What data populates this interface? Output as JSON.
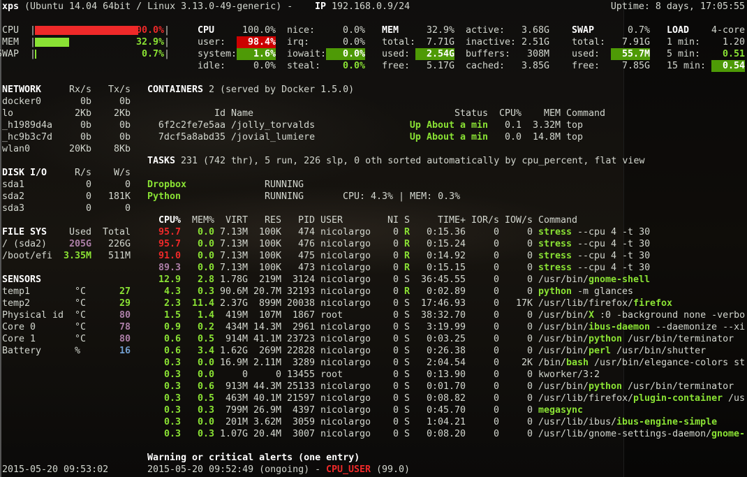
{
  "header": {
    "hostname": "xps",
    "system": "(Ubuntu 14.04 64bit / Linux 3.13.0-49-generic) - ",
    "ip_label": "IP",
    "ip": "192.168.0.9/24",
    "uptime": "Uptime: 8 days, 17:05:55"
  },
  "quicklook": [
    {
      "label": "CPU",
      "percent": 100.0,
      "text": "100.0%",
      "color": "#ef2929"
    },
    {
      "label": "MEM",
      "percent": 32.9,
      "text": "32.9%",
      "color": "#8ae234"
    },
    {
      "label": "SWAP",
      "percent": 0.7,
      "text": "0.7%",
      "color": "#8ae234"
    }
  ],
  "cpu": {
    "title": "CPU",
    "total": "100.0%",
    "left": [
      {
        "label": "user:",
        "value": "98.4%",
        "state": "critical-bg"
      },
      {
        "label": "system:",
        "value": "1.6%",
        "state": "ok-bg"
      },
      {
        "label": "idle:",
        "value": "0.0%",
        "state": ""
      }
    ],
    "right": [
      {
        "label": "nice:",
        "value": "0.0%",
        "state": ""
      },
      {
        "label": "irq:",
        "value": "0.0%",
        "state": ""
      },
      {
        "label": "iowait:",
        "value": "0.0%",
        "state": "ok-bg"
      },
      {
        "label": "steal:",
        "value": "0.0%",
        "state": "ok"
      }
    ]
  },
  "mem": {
    "title": "MEM",
    "total": "32.9%",
    "left": [
      {
        "label": "total:",
        "value": "7.71G",
        "state": ""
      },
      {
        "label": "used:",
        "value": "2.54G",
        "state": "ok-bg"
      },
      {
        "label": "free:",
        "value": "5.17G",
        "state": ""
      }
    ],
    "right": [
      {
        "label": "active:",
        "value": "3.68G",
        "state": ""
      },
      {
        "label": "inactive:",
        "value": "2.51G",
        "state": ""
      },
      {
        "label": "buffers:",
        "value": "308M",
        "state": ""
      },
      {
        "label": "cached:",
        "value": "3.85G",
        "state": ""
      }
    ]
  },
  "swap": {
    "title": "SWAP",
    "total": "0.7%",
    "rows": [
      {
        "label": "total:",
        "value": "7.91G",
        "state": ""
      },
      {
        "label": "used:",
        "value": "55.7M",
        "state": "ok-bg"
      },
      {
        "label": "free:",
        "value": "7.85G",
        "state": ""
      }
    ]
  },
  "load": {
    "title": "LOAD",
    "cores": "4-core",
    "rows": [
      {
        "label": "1 min:",
        "value": "1.20",
        "state": ""
      },
      {
        "label": "5 min:",
        "value": "0.51",
        "state": "ok"
      },
      {
        "label": "15 min:",
        "value": "0.54",
        "state": "ok-bg"
      }
    ]
  },
  "network": {
    "title": "NETWORK",
    "rx_label": "Rx/s",
    "tx_label": "Tx/s",
    "rows": [
      {
        "name": "docker0",
        "rx": "0b",
        "tx": "0b"
      },
      {
        "name": "lo",
        "rx": "2Kb",
        "tx": "2Kb"
      },
      {
        "name": "_h1989d4a",
        "rx": "0b",
        "tx": "0b"
      },
      {
        "name": "_hc9b3c7d",
        "rx": "0b",
        "tx": "0b"
      },
      {
        "name": "wlan0",
        "rx": "20Kb",
        "tx": "8Kb"
      }
    ]
  },
  "diskio": {
    "title": "DISK I/O",
    "r_label": "R/s",
    "w_label": "W/s",
    "rows": [
      {
        "name": "sda1",
        "r": "0",
        "w": "0"
      },
      {
        "name": "sda2",
        "r": "0",
        "w": "181K"
      },
      {
        "name": "sda3",
        "r": "0",
        "w": "0"
      }
    ]
  },
  "filesys": {
    "title": "FILE SYS",
    "used_label": "Used",
    "total_label": "Total",
    "rows": [
      {
        "name": "/ (sda2)",
        "used": "205G",
        "total": "226G",
        "state": "careful"
      },
      {
        "name": "/boot/efi",
        "used": "3.35M",
        "total": "511M",
        "state": "ok"
      }
    ]
  },
  "sensors": {
    "title": "SENSORS",
    "rows": [
      {
        "name": "temp1",
        "unit": "°C",
        "value": "27",
        "state": "ok"
      },
      {
        "name": "temp2",
        "unit": "°C",
        "value": "29",
        "state": "ok"
      },
      {
        "name": "Physical id",
        "unit": "°C",
        "value": "80",
        "state": "careful"
      },
      {
        "name": "Core 0",
        "unit": "°C",
        "value": "78",
        "state": "careful"
      },
      {
        "name": "Core 1",
        "unit": "°C",
        "value": "80",
        "state": "careful"
      },
      {
        "name": "Battery",
        "unit": "%",
        "value": "16",
        "state": "info"
      }
    ]
  },
  "containers": {
    "title": "CONTAINERS",
    "summary": "2 (served by Docker 1.5.0)",
    "columns": {
      "id": "Id",
      "name": "Name",
      "status": "Status",
      "cpu": "CPU%",
      "mem": "MEM",
      "command": "Command"
    },
    "rows": [
      {
        "id": "6f2c2fe7e5aa",
        "name": "/jolly_torvalds",
        "status": "Up About a min",
        "cpu": "0.1",
        "mem": "3.32M",
        "command": "top"
      },
      {
        "id": "7dcf5a8abd35",
        "name": "/jovial_lumiere",
        "status": "Up About a min",
        "cpu": "0.0",
        "mem": "14.8M",
        "command": "top"
      }
    ]
  },
  "tasks": {
    "title": "TASKS",
    "summary": "231 (742 thr), 5 run, 226 slp, 0 oth sorted automatically by cpu_percent, flat view"
  },
  "monitored": [
    {
      "name": "Dropbox",
      "status": "RUNNING",
      "info": ""
    },
    {
      "name": "Python",
      "status": "RUNNING",
      "info": "CPU: 4.3% | MEM: 0.3%"
    }
  ],
  "processes": {
    "columns": {
      "cpu": "CPU%",
      "mem": "MEM%",
      "virt": "VIRT",
      "res": "RES",
      "pid": "PID",
      "user": "USER",
      "ni": "NI",
      "s": "S",
      "time": "TIME+",
      "ior": "IOR/s",
      "iow": "IOW/s",
      "command": "Command"
    },
    "rows": [
      {
        "cpu": "95.7",
        "cpu_state": "critical",
        "mem": "0.0",
        "virt": "7.13M",
        "res": "100K",
        "pid": "474",
        "user": "nicolargo",
        "ni": "0",
        "s": "R",
        "time": "0:15.36",
        "ior": "0",
        "iow": "0",
        "cmd_pre": "",
        "cmd_name": "stress",
        "cmd_args": " --cpu 4 -t 30"
      },
      {
        "cpu": "95.7",
        "cpu_state": "critical",
        "mem": "0.0",
        "virt": "7.13M",
        "res": "100K",
        "pid": "476",
        "user": "nicolargo",
        "ni": "0",
        "s": "R",
        "time": "0:15.24",
        "ior": "0",
        "iow": "0",
        "cmd_pre": "",
        "cmd_name": "stress",
        "cmd_args": " --cpu 4 -t 30"
      },
      {
        "cpu": "91.0",
        "cpu_state": "critical",
        "mem": "0.0",
        "virt": "7.13M",
        "res": "100K",
        "pid": "475",
        "user": "nicolargo",
        "ni": "0",
        "s": "R",
        "time": "0:14.92",
        "ior": "0",
        "iow": "0",
        "cmd_pre": "",
        "cmd_name": "stress",
        "cmd_args": " --cpu 4 -t 30"
      },
      {
        "cpu": "89.3",
        "cpu_state": "careful",
        "mem": "0.0",
        "virt": "7.13M",
        "res": "100K",
        "pid": "473",
        "user": "nicolargo",
        "ni": "0",
        "s": "R",
        "time": "0:15.15",
        "ior": "0",
        "iow": "0",
        "cmd_pre": "",
        "cmd_name": "stress",
        "cmd_args": " --cpu 4 -t 30"
      },
      {
        "cpu": "12.9",
        "cpu_state": "ok",
        "mem": "2.8",
        "virt": "1.78G",
        "res": "219M",
        "pid": "3124",
        "user": "nicolargo",
        "ni": "0",
        "s": "S",
        "time": "36:45.55",
        "ior": "0",
        "iow": "0",
        "cmd_pre": "/usr/bin/",
        "cmd_name": "gnome-shell",
        "cmd_args": ""
      },
      {
        "cpu": "4.3",
        "cpu_state": "ok",
        "mem": "0.3",
        "virt": "90.6M",
        "res": "20.7M",
        "pid": "32193",
        "user": "nicolargo",
        "ni": "0",
        "s": "R",
        "time": "0:02.89",
        "ior": "0",
        "iow": "0",
        "cmd_pre": "",
        "cmd_name": "python",
        "cmd_args": " -m glances"
      },
      {
        "cpu": "2.3",
        "cpu_state": "ok",
        "mem": "11.4",
        "virt": "2.37G",
        "res": "899M",
        "pid": "20038",
        "user": "nicolargo",
        "ni": "0",
        "s": "S",
        "time": "17:46.93",
        "ior": "0",
        "iow": "17K",
        "cmd_pre": "/usr/lib/firefox/",
        "cmd_name": "firefox",
        "cmd_args": ""
      },
      {
        "cpu": "1.5",
        "cpu_state": "ok",
        "mem": "1.4",
        "virt": "419M",
        "res": "107M",
        "pid": "1867",
        "user": "root",
        "ni": "0",
        "s": "S",
        "time": "38:32.70",
        "ior": "0",
        "iow": "0",
        "cmd_pre": "/usr/bin/",
        "cmd_name": "X",
        "cmd_args": " :0 -background none -verbo"
      },
      {
        "cpu": "0.9",
        "cpu_state": "ok",
        "mem": "0.2",
        "virt": "434M",
        "res": "14.3M",
        "pid": "2961",
        "user": "nicolargo",
        "ni": "0",
        "s": "S",
        "time": "3:19.99",
        "ior": "0",
        "iow": "0",
        "cmd_pre": "/usr/bin/",
        "cmd_name": "ibus-daemon",
        "cmd_args": " --daemonize --xi"
      },
      {
        "cpu": "0.6",
        "cpu_state": "ok",
        "mem": "0.5",
        "virt": "914M",
        "res": "41.1M",
        "pid": "23723",
        "user": "nicolargo",
        "ni": "0",
        "s": "S",
        "time": "0:03.25",
        "ior": "0",
        "iow": "0",
        "cmd_pre": "/usr/bin/",
        "cmd_name": "python",
        "cmd_args": " /usr/bin/terminator"
      },
      {
        "cpu": "0.6",
        "cpu_state": "ok",
        "mem": "3.4",
        "virt": "1.62G",
        "res": "269M",
        "pid": "22828",
        "user": "nicolargo",
        "ni": "0",
        "s": "S",
        "time": "0:26.38",
        "ior": "0",
        "iow": "0",
        "cmd_pre": "/usr/bin/",
        "cmd_name": "perl",
        "cmd_args": " /usr/bin/shutter"
      },
      {
        "cpu": "0.3",
        "cpu_state": "ok",
        "mem": "0.0",
        "virt": "16.9M",
        "res": "2.11M",
        "pid": "3289",
        "user": "nicolargo",
        "ni": "0",
        "s": "S",
        "time": "2:04.54",
        "ior": "0",
        "iow": "2K",
        "cmd_pre": "/bin/",
        "cmd_name": "bash",
        "cmd_args": " /usr/bin/elegance-colors st"
      },
      {
        "cpu": "0.3",
        "cpu_state": "ok",
        "mem": "0.0",
        "virt": "0",
        "res": "0",
        "pid": "13455",
        "user": "root",
        "ni": "0",
        "s": "S",
        "time": "0:13.90",
        "ior": "0",
        "iow": "0",
        "cmd_pre": "kworker/3:2",
        "cmd_name": "",
        "cmd_args": ""
      },
      {
        "cpu": "0.3",
        "cpu_state": "ok",
        "mem": "0.6",
        "virt": "913M",
        "res": "44.3M",
        "pid": "25133",
        "user": "nicolargo",
        "ni": "0",
        "s": "S",
        "time": "0:01.70",
        "ior": "0",
        "iow": "0",
        "cmd_pre": "/usr/bin/",
        "cmd_name": "python",
        "cmd_args": " /usr/bin/terminator"
      },
      {
        "cpu": "0.3",
        "cpu_state": "ok",
        "mem": "0.5",
        "virt": "463M",
        "res": "40.1M",
        "pid": "21597",
        "user": "nicolargo",
        "ni": "0",
        "s": "S",
        "time": "0:08.82",
        "ior": "0",
        "iow": "0",
        "cmd_pre": "/usr/lib/firefox/",
        "cmd_name": "plugin-container",
        "cmd_args": " /us"
      },
      {
        "cpu": "0.3",
        "cpu_state": "ok",
        "mem": "0.3",
        "virt": "799M",
        "res": "26.9M",
        "pid": "4397",
        "user": "nicolargo",
        "ni": "0",
        "s": "S",
        "time": "0:45.70",
        "ior": "0",
        "iow": "0",
        "cmd_pre": "",
        "cmd_name": "megasync",
        "cmd_args": ""
      },
      {
        "cpu": "0.3",
        "cpu_state": "ok",
        "mem": "0.0",
        "virt": "201M",
        "res": "3.62M",
        "pid": "3059",
        "user": "nicolargo",
        "ni": "0",
        "s": "S",
        "time": "1:04.21",
        "ior": "0",
        "iow": "0",
        "cmd_pre": "/usr/lib/ibus/",
        "cmd_name": "ibus-engine-simple",
        "cmd_args": ""
      },
      {
        "cpu": "0.3",
        "cpu_state": "ok",
        "mem": "0.3",
        "virt": "1.07G",
        "res": "20.4M",
        "pid": "3007",
        "user": "nicolargo",
        "ni": "0",
        "s": "S",
        "time": "0:08.20",
        "ior": "0",
        "iow": "0",
        "cmd_pre": "/usr/lib/gnome-settings-daemon/",
        "cmd_name": "gnome-",
        "cmd_args": ""
      }
    ]
  },
  "alerts": {
    "title": "Warning or critical alerts (one entry)",
    "entry_time": "2015-05-20 09:52:49 (ongoing) - ",
    "entry_type": "CPU_USER",
    "entry_value": " (99.0)"
  },
  "footer": {
    "datetime": "2015-05-20 09:53:02"
  },
  "colors": {
    "ok": "#8ae234",
    "critical": "#ef2929",
    "careful": "#ad7fa8",
    "info": "#729fcf",
    "ok_bg": "#4e9a06",
    "critical_bg": "#cc0000"
  }
}
